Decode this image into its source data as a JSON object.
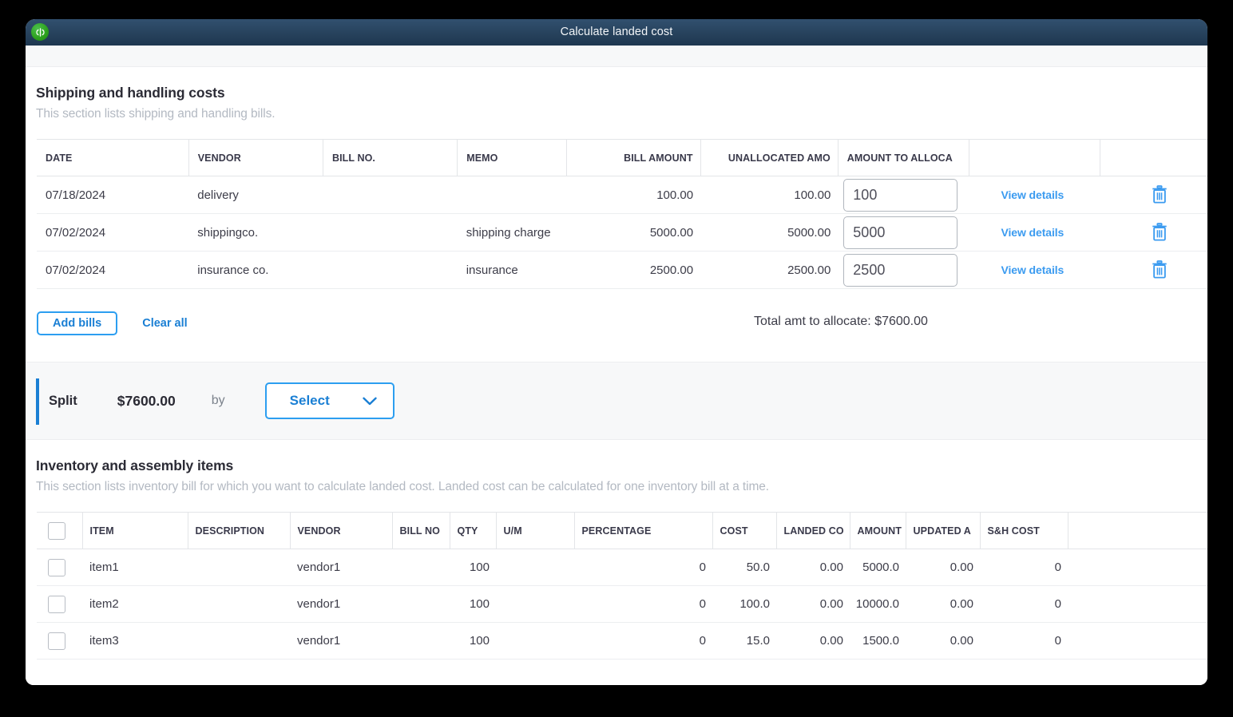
{
  "window": {
    "title": "Calculate landed cost",
    "logo_icon": "quickbooks-logo-icon"
  },
  "shipping_section": {
    "title": "Shipping and handling costs",
    "subtitle": "This section lists shipping and handling bills.",
    "columns": [
      "DATE",
      "VENDOR",
      "BILL NO.",
      "MEMO",
      "BILL AMOUNT",
      "UNALLOCATED AMO",
      "AMOUNT TO ALLOCA",
      "",
      ""
    ],
    "rows": [
      {
        "date": "07/18/2024",
        "vendor": "delivery",
        "bill_no": "",
        "memo": "",
        "bill_amount": "100.00",
        "unallocated_amount": "100.00",
        "amount_to_allocate": "100",
        "view_details": "View details",
        "delete_icon": "trash-icon"
      },
      {
        "date": "07/02/2024",
        "vendor": "shippingco.",
        "bill_no": "",
        "memo": "shipping charge",
        "bill_amount": "5000.00",
        "unallocated_amount": "5000.00",
        "amount_to_allocate": "5000",
        "view_details": "View details",
        "delete_icon": "trash-icon"
      },
      {
        "date": "07/02/2024",
        "vendor": "insurance co.",
        "bill_no": "",
        "memo": "insurance",
        "bill_amount": "2500.00",
        "unallocated_amount": "2500.00",
        "amount_to_allocate": "2500",
        "view_details": "View details",
        "delete_icon": "trash-icon"
      }
    ],
    "add_bills_label": "Add bills",
    "clear_all_label": "Clear all",
    "total_text": "Total amt to allocate: $7600.00"
  },
  "split_bar": {
    "label": "Split",
    "amount": "$7600.00",
    "by": "by",
    "select_label": "Select",
    "chevron_icon": "chevron-down-icon"
  },
  "inventory_section": {
    "title": "Inventory and assembly items",
    "subtitle": "This section lists inventory bill for which you want to calculate landed cost. Landed cost can be calculated for one inventory bill at a time.",
    "columns": [
      "",
      "ITEM",
      "DESCRIPTION",
      "VENDOR",
      "BILL NO",
      "QTY",
      "U/M",
      "PERCENTAGE",
      "COST",
      "LANDED CO",
      "AMOUNT",
      "UPDATED A",
      "S&H COST"
    ],
    "rows": [
      {
        "selected": false,
        "item": "item1",
        "description": "",
        "vendor": "vendor1",
        "bill_no": "",
        "qty": "100",
        "um": "",
        "percentage": "0",
        "cost": "50.0",
        "landed_cost": "0.00",
        "amount": "5000.0",
        "updated_amount": "0.00",
        "sh_cost": "0"
      },
      {
        "selected": false,
        "item": "item2",
        "description": "",
        "vendor": "vendor1",
        "bill_no": "",
        "qty": "100",
        "um": "",
        "percentage": "0",
        "cost": "100.0",
        "landed_cost": "0.00",
        "amount": "10000.0",
        "updated_amount": "0.00",
        "sh_cost": "0"
      },
      {
        "selected": false,
        "item": "item3",
        "description": "",
        "vendor": "vendor1",
        "bill_no": "",
        "qty": "100",
        "um": "",
        "percentage": "0",
        "cost": "15.0",
        "landed_cost": "0.00",
        "amount": "1500.0",
        "updated_amount": "0.00",
        "sh_cost": "0"
      }
    ]
  },
  "colors": {
    "titlebar": "#27425c",
    "brand_green": "#2ca01c",
    "link_blue": "#1a7fd4",
    "accent_blue": "#2c9ef0",
    "muted_text": "#b3b9c2"
  }
}
